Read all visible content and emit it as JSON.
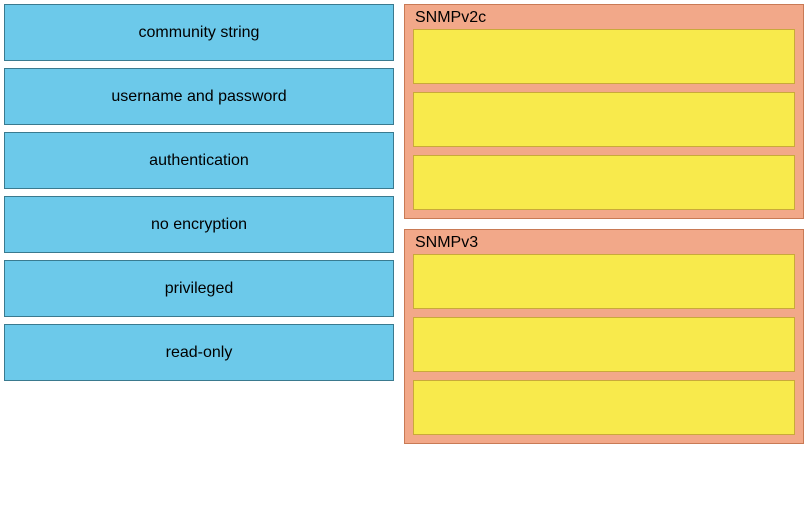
{
  "sources": [
    "community string",
    "username and password",
    "authentication",
    "no encryption",
    "privileged",
    "read-only"
  ],
  "targets": [
    {
      "title": "SNMPv2c",
      "slots": 3
    },
    {
      "title": "SNMPv3",
      "slots": 3
    }
  ],
  "colors": {
    "sourceBg": "#6cc9ea",
    "targetBg": "#f2a889",
    "slotBg": "#f8ea4c"
  }
}
